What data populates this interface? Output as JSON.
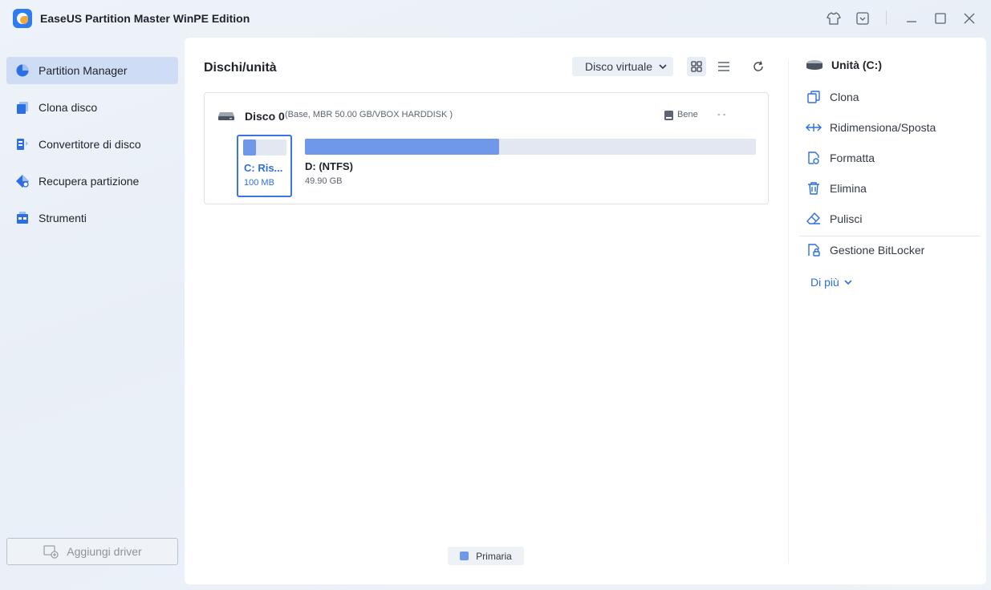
{
  "app": {
    "title": "EaseUS Partition Master WinPE Edition"
  },
  "sidebar": {
    "items": [
      {
        "label": "Partition Manager",
        "icon": "pie-chart-icon",
        "active": true
      },
      {
        "label": "Clona disco",
        "icon": "clone-disk-icon"
      },
      {
        "label": "Convertitore di disco",
        "icon": "convert-disk-icon"
      },
      {
        "label": "Recupera partizione",
        "icon": "recover-partition-icon"
      },
      {
        "label": "Strumenti",
        "icon": "tools-icon"
      }
    ],
    "add_driver_label": "Aggiungi driver"
  },
  "main": {
    "title": "Dischi/unità",
    "virtual_disk_label": "Disco virtuale",
    "disk": {
      "name": "Disco 0",
      "info": "(Base, MBR 50.00 GB/VBOX HARDDISK )",
      "health": "Bene",
      "extra": "- -",
      "partitions": [
        {
          "label": "C: Ris...",
          "size": "100 MB",
          "used_fraction": 0.3,
          "selected": true
        },
        {
          "label": "D: (NTFS)",
          "size": "49.90 GB",
          "used_fraction": 0.43
        }
      ]
    },
    "legend": {
      "primary_label": "Primaria",
      "primary_color": "#6f98ea"
    }
  },
  "right_panel": {
    "header": "Unità (C:)",
    "actions": [
      {
        "label": "Clona",
        "icon": "clone-icon"
      },
      {
        "label": "Ridimensiona/Sposta",
        "icon": "resize-icon"
      },
      {
        "label": "Formatta",
        "icon": "format-icon"
      },
      {
        "label": "Elimina",
        "icon": "trash-icon"
      },
      {
        "label": "Pulisci",
        "icon": "eraser-icon"
      }
    ],
    "bitlocker_label": "Gestione BitLocker",
    "more_label": "Di più"
  },
  "colors": {
    "accent": "#2d6fe0",
    "active_nav": "#cfdcf5",
    "partition_fill": "#6f98ea"
  }
}
